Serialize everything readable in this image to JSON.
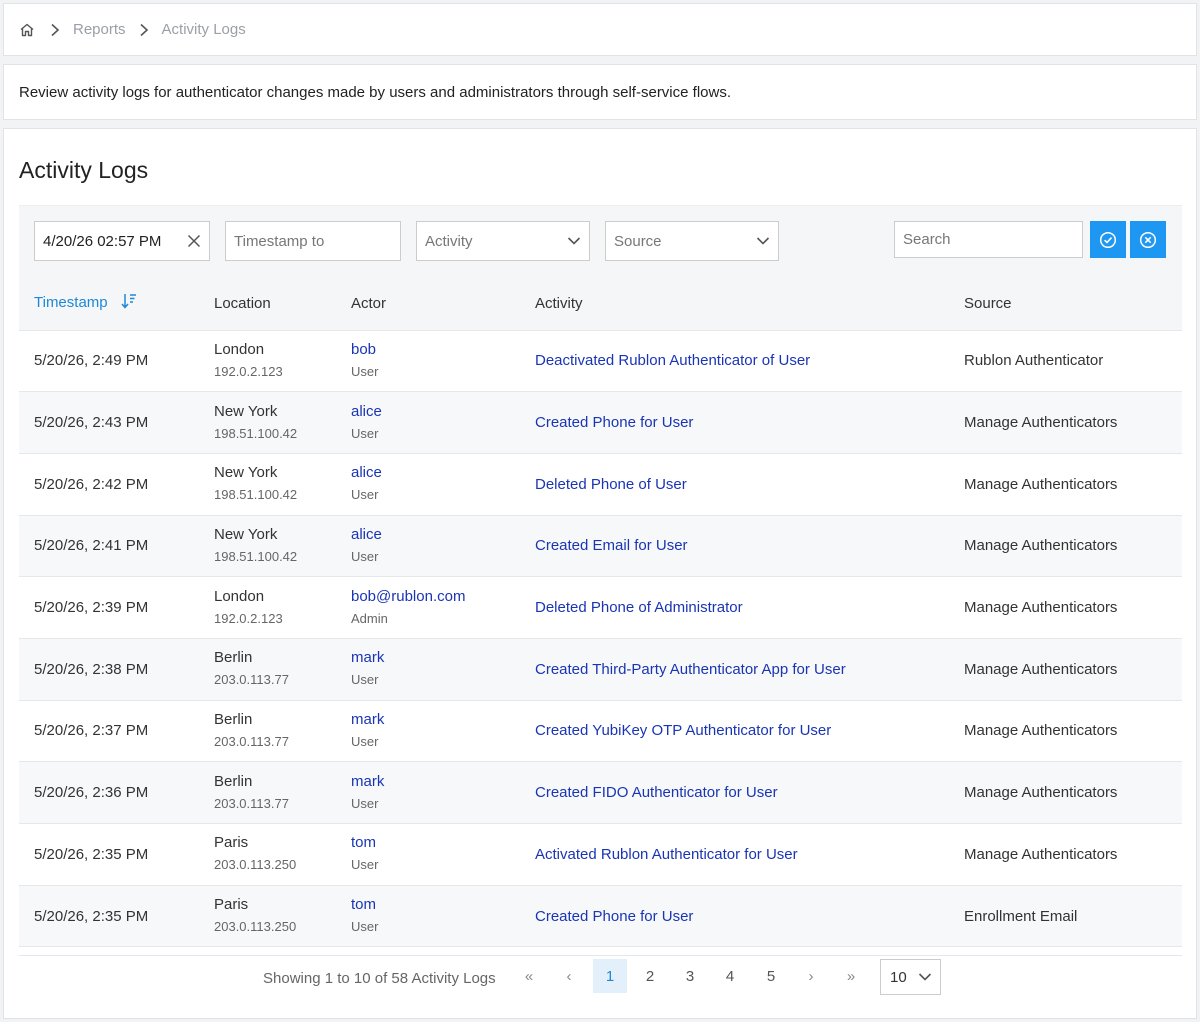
{
  "breadcrumb": {
    "items": [
      "Reports",
      "Activity Logs"
    ]
  },
  "description": "Review activity logs for authenticator changes made by users and administrators through self-service flows.",
  "page_title": "Activity Logs",
  "filters": {
    "timestamp_from_value": "4/20/26 02:57 PM",
    "timestamp_to_placeholder": "Timestamp to",
    "activity_placeholder": "Activity",
    "source_placeholder": "Source",
    "search_placeholder": "Search"
  },
  "table": {
    "headers": {
      "timestamp": "Timestamp",
      "location": "Location",
      "actor": "Actor",
      "activity": "Activity",
      "source": "Source"
    },
    "rows": [
      {
        "timestamp": "5/20/26, 2:49 PM",
        "city": "London",
        "ip": "192.0.2.123",
        "actor": "bob",
        "role": "User",
        "activity": "Deactivated Rublon Authenticator of User",
        "source": "Rublon Authenticator"
      },
      {
        "timestamp": "5/20/26, 2:43 PM",
        "city": "New York",
        "ip": "198.51.100.42",
        "actor": "alice",
        "role": "User",
        "activity": "Created Phone for User",
        "source": "Manage Authenticators"
      },
      {
        "timestamp": "5/20/26, 2:42 PM",
        "city": "New York",
        "ip": "198.51.100.42",
        "actor": "alice",
        "role": "User",
        "activity": "Deleted Phone of User",
        "source": "Manage Authenticators"
      },
      {
        "timestamp": "5/20/26, 2:41 PM",
        "city": "New York",
        "ip": "198.51.100.42",
        "actor": "alice",
        "role": "User",
        "activity": "Created Email for User",
        "source": "Manage Authenticators"
      },
      {
        "timestamp": "5/20/26, 2:39 PM",
        "city": "London",
        "ip": "192.0.2.123",
        "actor": "bob@rublon.com",
        "role": "Admin",
        "activity": "Deleted Phone of Administrator",
        "source": "Manage Authenticators"
      },
      {
        "timestamp": "5/20/26, 2:38 PM",
        "city": "Berlin",
        "ip": "203.0.113.77",
        "actor": "mark",
        "role": "User",
        "activity": "Created Third-Party Authenticator App for User",
        "source": "Manage Authenticators"
      },
      {
        "timestamp": "5/20/26, 2:37 PM",
        "city": "Berlin",
        "ip": "203.0.113.77",
        "actor": "mark",
        "role": "User",
        "activity": "Created YubiKey OTP Authenticator for User",
        "source": "Manage Authenticators"
      },
      {
        "timestamp": "5/20/26, 2:36 PM",
        "city": "Berlin",
        "ip": "203.0.113.77",
        "actor": "mark",
        "role": "User",
        "activity": "Created FIDO Authenticator for User",
        "source": "Manage Authenticators"
      },
      {
        "timestamp": "5/20/26, 2:35 PM",
        "city": "Paris",
        "ip": "203.0.113.250",
        "actor": "tom",
        "role": "User",
        "activity": "Activated Rublon Authenticator for User",
        "source": "Manage Authenticators"
      },
      {
        "timestamp": "5/20/26, 2:35 PM",
        "city": "Paris",
        "ip": "203.0.113.250",
        "actor": "tom",
        "role": "User",
        "activity": "Created Phone for User",
        "source": "Enrollment Email"
      }
    ]
  },
  "pagination": {
    "summary": "Showing 1 to 10 of 58 Activity Logs",
    "first": "«",
    "prev": "‹",
    "pages": [
      "1",
      "2",
      "3",
      "4",
      "5"
    ],
    "active_page": "1",
    "next": "›",
    "last": "»",
    "page_size": "10"
  },
  "colors": {
    "accent": "#1e97f3",
    "link": "#1a35b4",
    "sort_header": "#1e88d6"
  },
  "icons": {
    "home": "home-icon",
    "separator": "chevron-right-icon",
    "clear": "close-icon",
    "dropdown": "chevron-down-icon",
    "sort": "sort-descending-icon",
    "apply": "check-circle-icon",
    "reset": "x-circle-icon"
  }
}
